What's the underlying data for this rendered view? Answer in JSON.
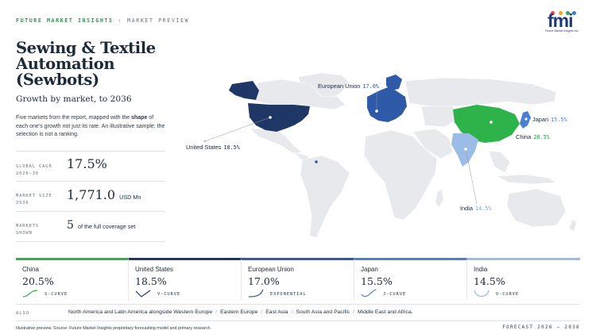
{
  "header": {
    "brand": "FUTURE MARKET INSIGHTS",
    "separator": "·",
    "section": "MARKET PREVIEW"
  },
  "logo": {
    "mark": "fmi",
    "tagline": "Future Market Insights Inc.",
    "dot_colors": [
      "#e8473f",
      "#f3a51f",
      "#3aa856",
      "#3a7fd0"
    ]
  },
  "title": "Sewing & Textile Automation (Sewbots)",
  "subtitle": "Growth by market, to 2036",
  "description": {
    "part1": "Five markets from the report, mapped with the ",
    "emphasis": "shape",
    "part2": " of each one’s growth not just its rate. An illustrative sample; the selection is not a ranking."
  },
  "stats": [
    {
      "label": "GLOBAL CAGR\n2026–36",
      "value": "17.5%",
      "unit": ""
    },
    {
      "label": "MARKET SIZE\n2036",
      "value": "1,771.0",
      "unit": "USD Mn"
    },
    {
      "label": "MARKETS\nSHOWN",
      "value": "5",
      "unit": "of the full coverage set"
    }
  ],
  "colors": {
    "china": "#2db34a",
    "united_states": "#1f3766",
    "european_union": "#2e5aa8",
    "japan": "#4a7fd4",
    "india": "#9bbce4",
    "land": "#e7e9ec"
  },
  "map": {
    "callouts": [
      {
        "name": "European Union",
        "pct": "17.0%"
      },
      {
        "name": "Japan",
        "pct": "15.5%"
      },
      {
        "name": "China",
        "pct": "20.5%"
      },
      {
        "name": "United States",
        "pct": "18.5%"
      },
      {
        "name": "India",
        "pct": "14.5%"
      }
    ]
  },
  "cards": [
    {
      "name": "China",
      "value": "20.5%",
      "curve": "S-CURVE",
      "color": "#2db34a"
    },
    {
      "name": "United States",
      "value": "18.5%",
      "curve": "V-CURVE",
      "color": "#1f3766"
    },
    {
      "name": "European Union",
      "value": "17.0%",
      "curve": "EXPONENTIAL",
      "color": "#2e5aa8"
    },
    {
      "name": "Japan",
      "value": "15.5%",
      "curve": "J-CURVE",
      "color": "#4a7fd4"
    },
    {
      "name": "India",
      "value": "14.5%",
      "curve": "U-CURVE",
      "color": "#9bbce4"
    }
  ],
  "also": {
    "label": "ALSO",
    "items": [
      "North America and Latin America alongside Western Europe",
      "Eastern Europe",
      "East Asia",
      "South Asia and Pacific",
      "Middle East and Africa."
    ]
  },
  "footer": {
    "source": "Illustrative preview. Source: Future Market Insights proprietary forecasting model and primary research.",
    "forecast": "FORECAST 2026 – 2036"
  }
}
